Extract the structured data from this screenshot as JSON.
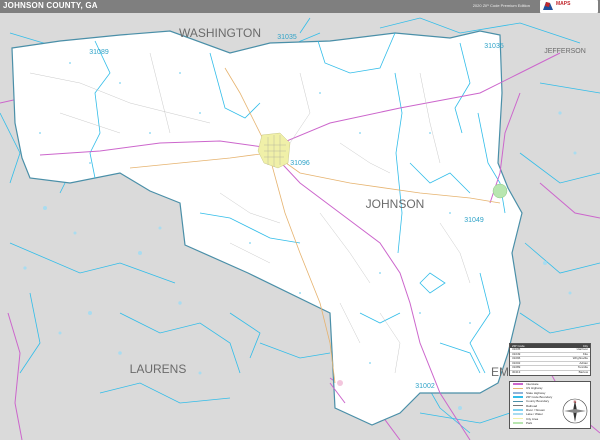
{
  "header": {
    "title": "JOHNSON COUNTY, GA",
    "edition": "2020 ZIP Code Premium Edition",
    "logo_text": "MAPS"
  },
  "map": {
    "counties": [
      {
        "name": "WASHINGTON",
        "focus": false
      },
      {
        "name": "JEFFERSON",
        "focus": false
      },
      {
        "name": "JOHNSON",
        "focus": true
      },
      {
        "name": "LAURENS",
        "focus": false
      },
      {
        "name": "EMANUEL",
        "focus": false
      }
    ],
    "zip_codes": [
      "31089",
      "31035",
      "31035",
      "31096",
      "31049",
      "31002"
    ],
    "colors": {
      "focus_county": "#ffffff",
      "surrounding": "#dadada",
      "zip_boundary": "#32bde9",
      "county_boundary": "#4a8fa8",
      "highway": "#cc66cc",
      "major_road": "#e6b36f",
      "city": "#f0f0a8",
      "town": "#b8e6b0"
    }
  },
  "zip_table": {
    "headers": [
      "ZIP Code",
      "City"
    ],
    "rows": [
      [
        "31035",
        "Harrison"
      ],
      [
        "31049",
        "Kite"
      ],
      [
        "31096",
        "Wrightsville"
      ],
      [
        "31002",
        "Adrian"
      ],
      [
        "31089",
        "Tennille"
      ],
      [
        "30413",
        "Bartow"
      ]
    ]
  },
  "legend": {
    "items": [
      {
        "label": "Interstate",
        "color": "#cc66cc"
      },
      {
        "label": "US Highway",
        "color": "#e6b36f"
      },
      {
        "label": "State Highway",
        "color": "#8fb3d9"
      },
      {
        "label": "ZIP Code Boundary",
        "color": "#32bde9"
      },
      {
        "label": "County Boundary",
        "color": "#4a8fa8"
      },
      {
        "label": "Railroad",
        "color": "#777777"
      },
      {
        "label": "River / Stream",
        "color": "#7fd3f0"
      },
      {
        "label": "Lake / Water",
        "color": "#a9dcf0"
      },
      {
        "label": "City Area",
        "color": "#f0f0a8"
      },
      {
        "label": "Park",
        "color": "#b8e6b0"
      }
    ]
  }
}
